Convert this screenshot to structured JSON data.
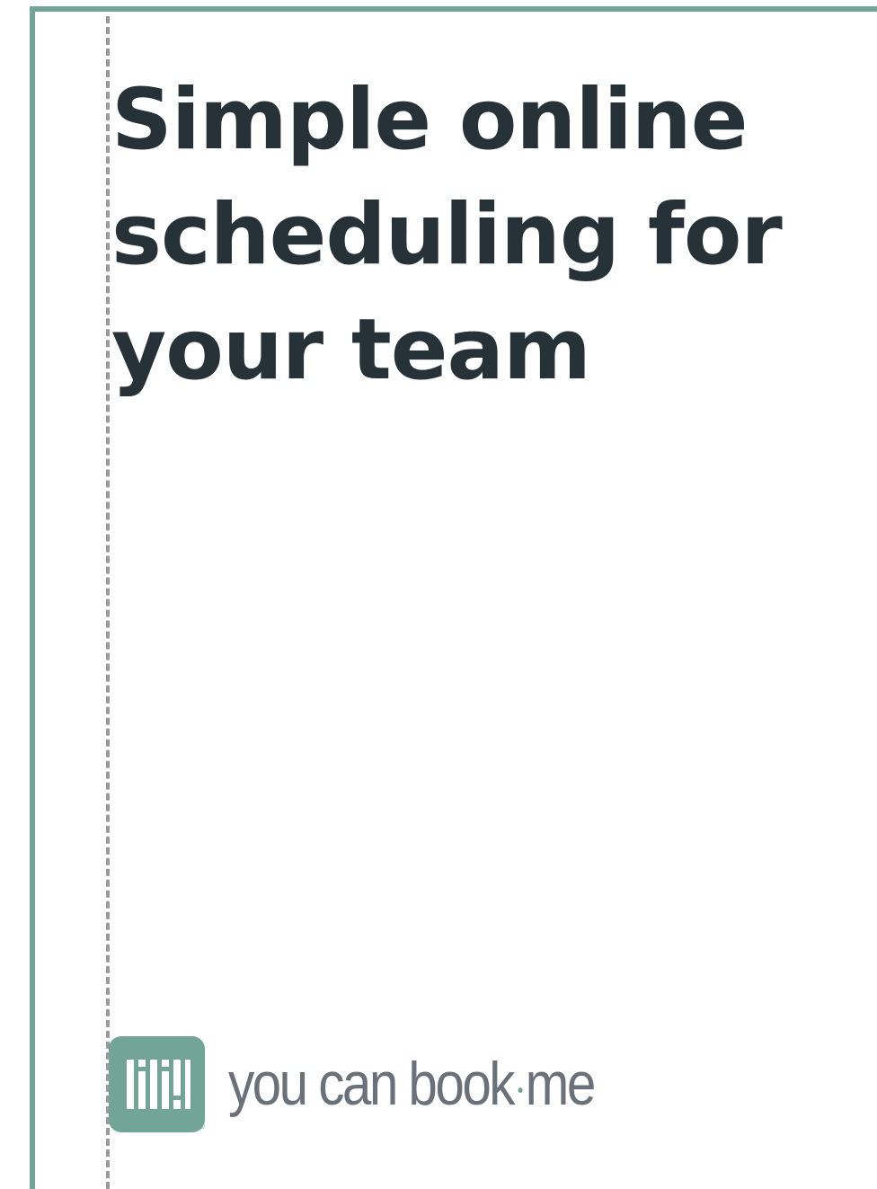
{
  "headline": {
    "lines": [
      "Simple online",
      "scheduling for",
      "your team"
    ]
  },
  "logo": {
    "icon": "youcanbookme-logo-icon",
    "word_part1": "you can book",
    "word_part2": "me",
    "registered": "®"
  },
  "colors": {
    "accent": "#72a595",
    "text": "#263238",
    "logo_text": "#6b717a",
    "guide": "#9a9a9a"
  }
}
